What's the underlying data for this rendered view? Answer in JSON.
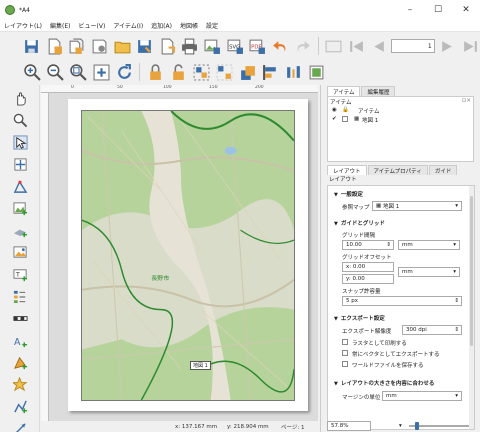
{
  "window": {
    "title": "*A4"
  },
  "window_buttons": [
    "–",
    "☐",
    "✕"
  ],
  "menu": [
    "レイアウト(L)",
    "編集(E)",
    "ビュー(V)",
    "アイテム(I)",
    "追加(A)",
    "地図帳",
    "設定"
  ],
  "toolbar": {
    "page_value": "1"
  },
  "ruler": {
    "top_ticks": [
      "0",
      "50",
      "100",
      "150",
      "200"
    ]
  },
  "map": {
    "label": "地図 1",
    "area_label": "長野市"
  },
  "status": {
    "x": "x: 137.167 mm",
    "y": "y: 218.904 mm",
    "page": "ページ: 1",
    "zoom": "57.8%"
  },
  "items_panel": {
    "tabs": [
      "アイテム",
      "編集履歴"
    ],
    "header": "アイテム",
    "column": "アイテム",
    "rows": [
      {
        "name": "地図 1",
        "checked": true
      }
    ]
  },
  "layout_panel": {
    "tabs": [
      "レイアウト",
      "アイテムプロパティ",
      "ガイド"
    ],
    "header": "レイアウト",
    "general": {
      "title": "一般設定",
      "ref_map_label": "参照マップ",
      "ref_map_value": "地図 1"
    },
    "guides": {
      "title": "ガイドとグリッド",
      "spacing_label": "グリッド間隔",
      "spacing_value": "10.00",
      "spacing_unit": "mm",
      "offset_label": "グリッドオフセット",
      "offset_x": "x: 0.00",
      "offset_y": "y: 0.00",
      "offset_unit": "mm",
      "snap_label": "スナップ許容量",
      "snap_value": "5 px"
    },
    "export": {
      "title": "エクスポート設定",
      "dpi_label": "エクスポート解像度",
      "dpi_value": "300 dpi",
      "opt1": "ラスタとして印刷する",
      "opt2": "常にベクタとしてエクスポートする",
      "opt3": "ワールドファイルを保存する"
    },
    "resize": {
      "title": "レイアウトの大きさを内容に合わせる",
      "margin_label": "マージンの単位",
      "margin_unit": "mm"
    }
  },
  "colors": {
    "accent": "#3c6ea8",
    "map_forest": "#b4d49a",
    "boundary": "#2d8a2d"
  }
}
